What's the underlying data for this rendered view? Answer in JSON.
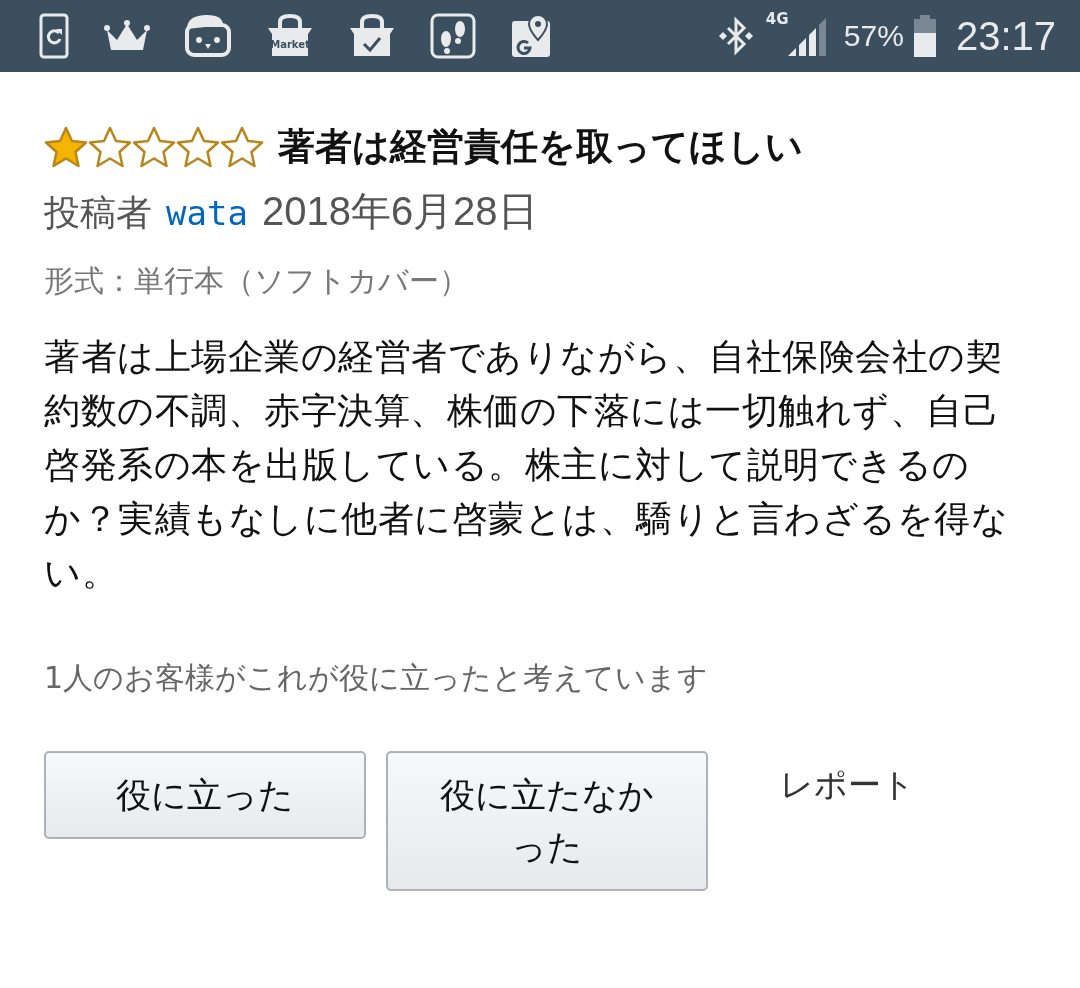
{
  "status_bar": {
    "market_icon_label": "Market",
    "network": "4G",
    "battery": "57%",
    "time": "23:17"
  },
  "review": {
    "stars": 1,
    "title": "著者は経営責任を取ってほしい",
    "author_label": "投稿者",
    "author": "wata",
    "date": "2018年6月28日",
    "format": "形式：単行本（ソフトカバー）",
    "body": "著者は上場企業の経営者でありながら、自社保険会社の契約数の不調、赤字決算、株価の下落には一切触れず、自己啓発系の本を出版している。株主に対して説明できるのか？実績もなしに他者に啓蒙とは、驕りと言わざるを得ない。",
    "helpful_count": "1人のお客様がこれが役に立ったと考えています"
  },
  "buttons": [
    {
      "label": "役に立った",
      "kind": "button"
    },
    {
      "label": "役に立たなかった",
      "kind": "button"
    },
    {
      "label": "レポート",
      "kind": "link"
    }
  ]
}
